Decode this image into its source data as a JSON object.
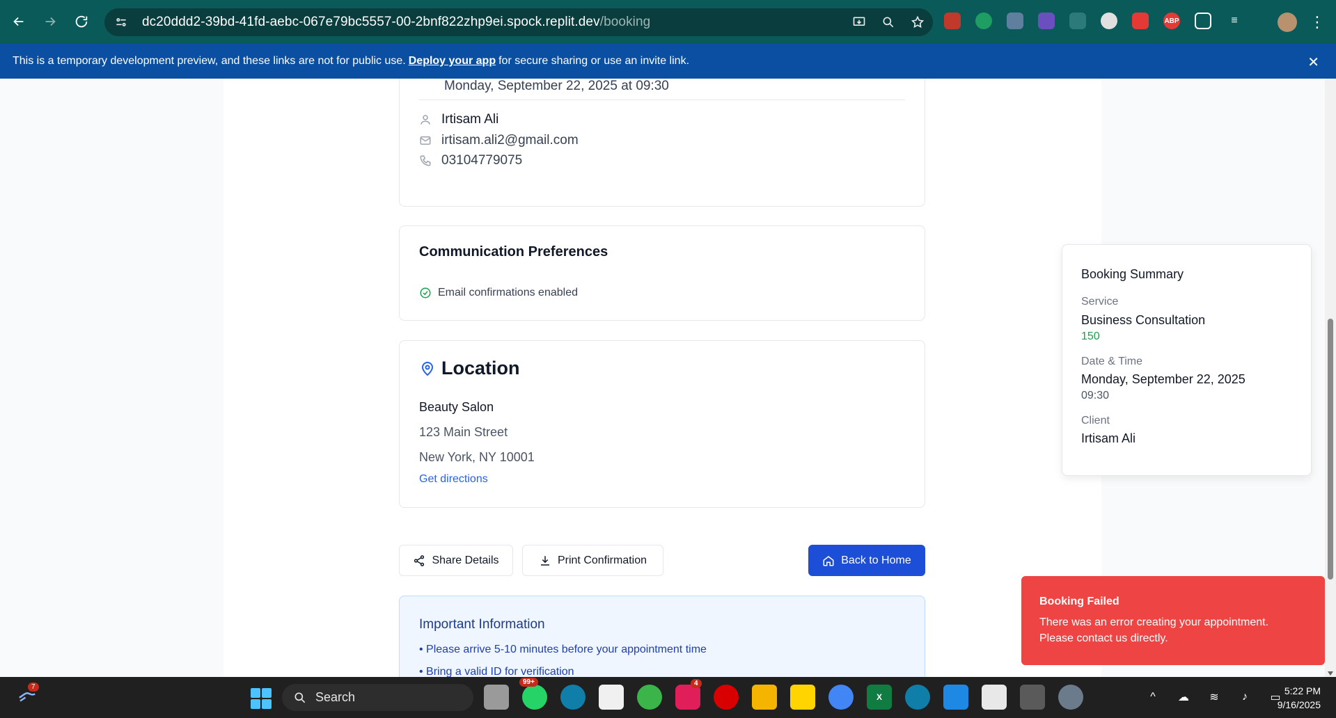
{
  "browser": {
    "url_host": "dc20ddd2-39bd-41fd-aebc-067e79bc5557-00-2bnf822zhp9ei.spock.replit.dev",
    "url_path": "/booking"
  },
  "dev_banner": {
    "text_before": "This is a temporary development preview, and these links are not for public use.",
    "link": "Deploy your app",
    "text_after": "for secure sharing or use an invite link."
  },
  "details": {
    "datetime": "Monday, September 22, 2025 at 09:30",
    "name": "Irtisam Ali",
    "email": "irtisam.ali2@gmail.com",
    "phone": "03104779075"
  },
  "communication": {
    "title": "Communication Preferences",
    "email_pref": "Email confirmations enabled"
  },
  "location": {
    "title": "Location",
    "name": "Beauty Salon",
    "street": "123 Main Street",
    "city": "New York, NY 10001",
    "directions": "Get directions"
  },
  "actions": {
    "share": "Share Details",
    "print": "Print Confirmation",
    "home": "Back to Home"
  },
  "important": {
    "title": "Important Information",
    "items": [
      "• Please arrive 5-10 minutes before your appointment time",
      "• Bring a valid ID for verification"
    ]
  },
  "summary": {
    "title": "Booking Summary",
    "service_label": "Service",
    "service": "Business Consultation",
    "price": "150",
    "datetime_label": "Date & Time",
    "date": "Monday, September 22, 2025",
    "time": "09:30",
    "client_label": "Client",
    "client": "Irtisam Ali"
  },
  "toast": {
    "title": "Booking Failed",
    "message": "There was an error creating your appointment. Please contact us directly."
  },
  "taskbar": {
    "search": "Search",
    "time": "5:22 PM",
    "date": "9/16/2025",
    "widget_badge": "7",
    "whatsapp_badge": "99+",
    "slack_badge": "4"
  },
  "colors": {
    "primary": "#1d4ed8",
    "error": "#ef4444",
    "success": "#16a34a",
    "chrome": "#0b5a5a",
    "banner": "#0a4fa1"
  }
}
